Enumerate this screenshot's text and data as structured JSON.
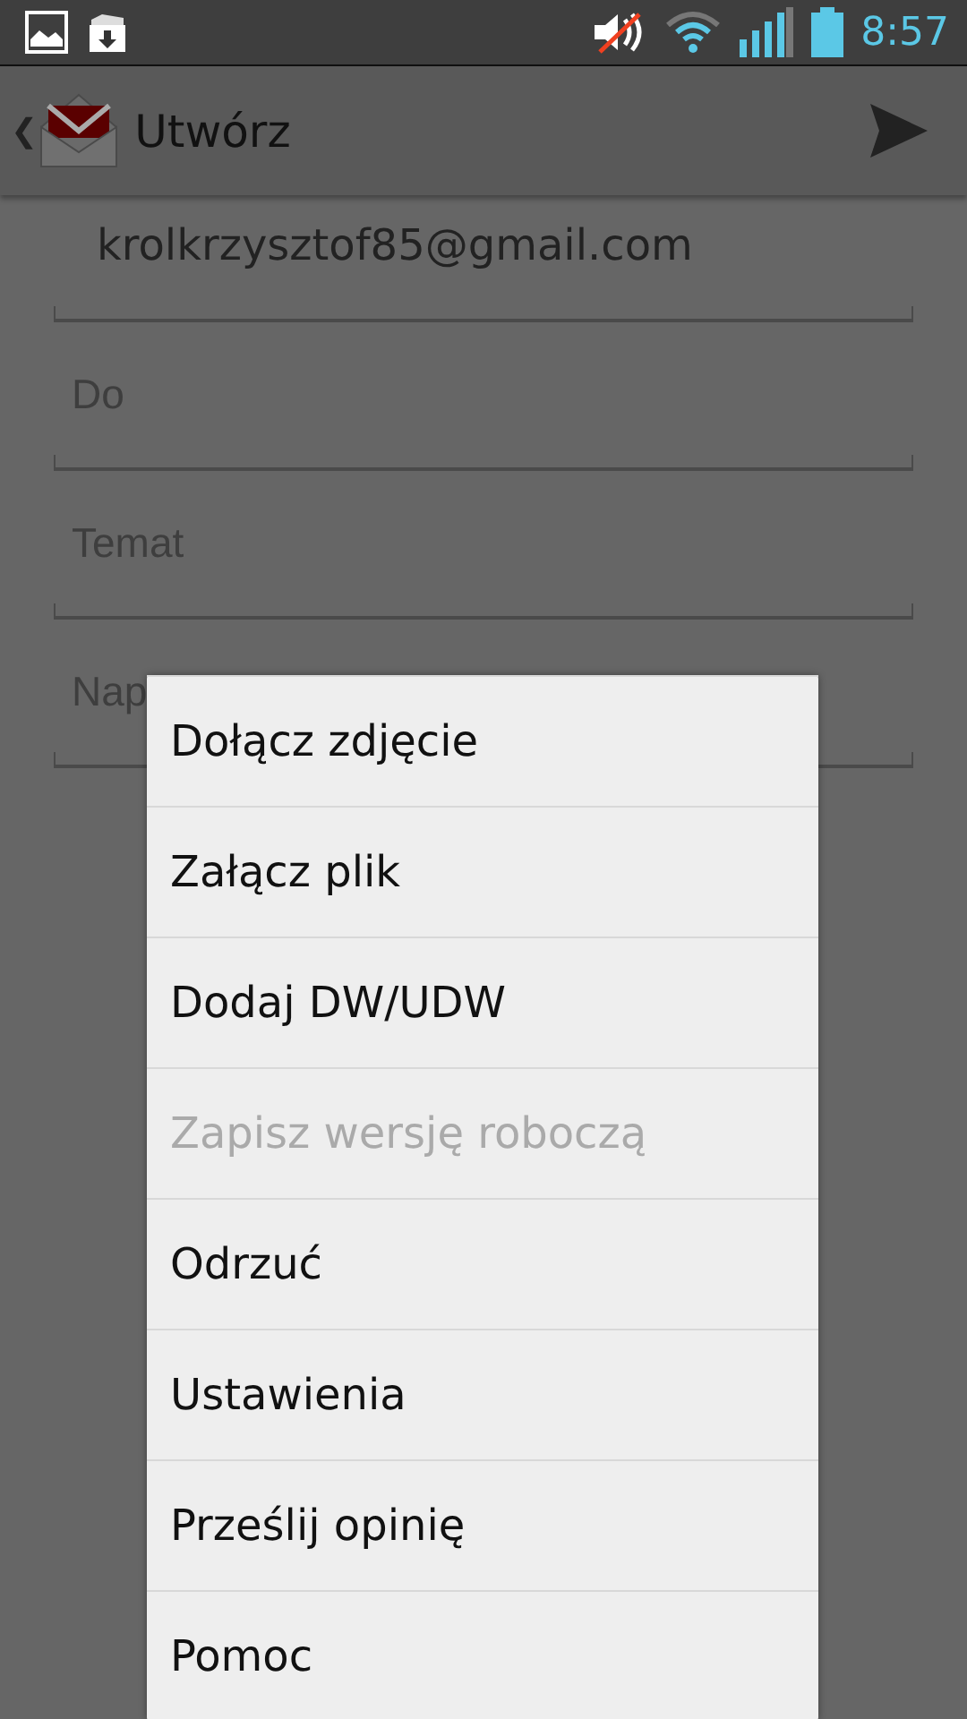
{
  "status_bar": {
    "time": "8:57"
  },
  "action_bar": {
    "back": "❮",
    "title": "Utwórz"
  },
  "form": {
    "from": "krolkrzysztof85@gmail.com",
    "fields": [
      {
        "placeholder": "Do"
      },
      {
        "placeholder": "Temat"
      },
      {
        "placeholder": "Nap"
      }
    ]
  },
  "menu": [
    {
      "label": "Dołącz zdjęcie",
      "disabled": false
    },
    {
      "label": "Załącz plik",
      "disabled": false
    },
    {
      "label": "Dodaj DW/UDW",
      "disabled": false
    },
    {
      "label": "Zapisz wersję roboczą",
      "disabled": true
    },
    {
      "label": "Odrzuć",
      "disabled": false
    },
    {
      "label": "Ustawienia",
      "disabled": false
    },
    {
      "label": "Prześlij opinię",
      "disabled": false
    },
    {
      "label": "Pomoc",
      "disabled": false
    }
  ]
}
